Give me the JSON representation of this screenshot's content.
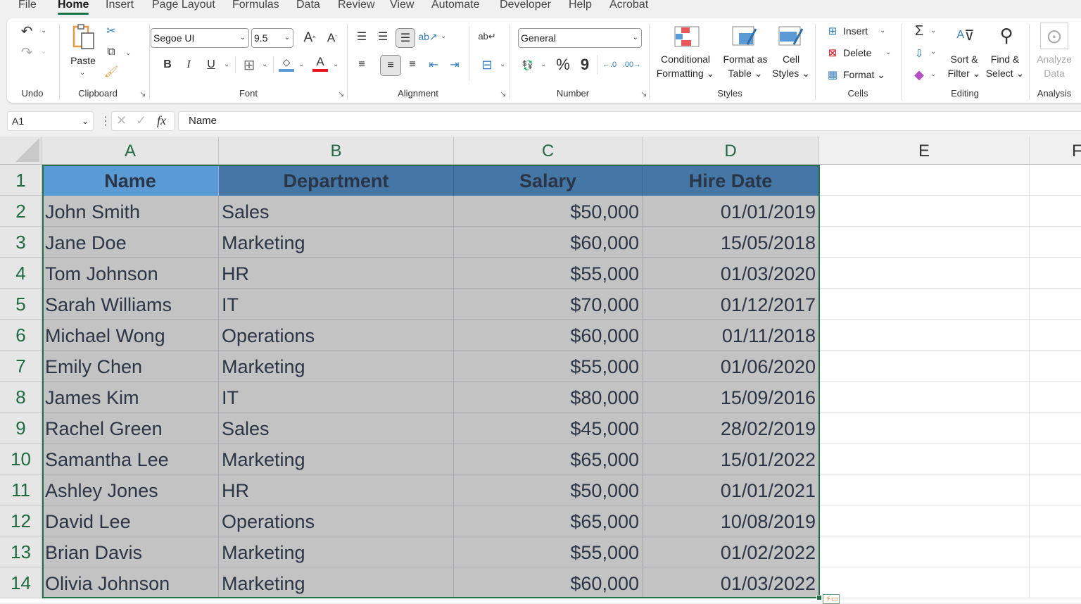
{
  "tabs": [
    "File",
    "Home",
    "Insert",
    "Page Layout",
    "Formulas",
    "Data",
    "Review",
    "View",
    "Automate",
    "Developer",
    "Help",
    "Acrobat"
  ],
  "active_tab": "Home",
  "ribbon": {
    "undo": {
      "label": "Undo"
    },
    "clipboard": {
      "label": "Clipboard",
      "paste": "Paste"
    },
    "font": {
      "label": "Font",
      "font_name": "Segoe UI",
      "font_size": "9.5",
      "bold": "B",
      "italic": "I",
      "underline": "U"
    },
    "alignment": {
      "label": "Alignment"
    },
    "number": {
      "label": "Number",
      "format": "General",
      "percent": "%",
      "comma": "9"
    },
    "styles": {
      "label": "Styles",
      "conditional_1": "Conditional",
      "conditional_2": "Formatting",
      "format_table_1": "Format as",
      "format_table_2": "Table",
      "cell_styles_1": "Cell",
      "cell_styles_2": "Styles"
    },
    "cells": {
      "label": "Cells",
      "insert": "Insert",
      "delete": "Delete",
      "format": "Format"
    },
    "editing": {
      "label": "Editing",
      "sort_1": "Sort &",
      "sort_2": "Filter",
      "find_1": "Find &",
      "find_2": "Select"
    },
    "analysis": {
      "label": "Analysis",
      "analyze_1": "Analyze",
      "analyze_2": "Data"
    }
  },
  "formula_bar": {
    "name_box": "A1",
    "fx": "fx",
    "content": "Name"
  },
  "columns": [
    "A",
    "B",
    "C",
    "D",
    "E",
    "F"
  ],
  "rows": [
    "1",
    "2",
    "3",
    "4",
    "5",
    "6",
    "7",
    "8",
    "9",
    "10",
    "11",
    "12",
    "13",
    "14"
  ],
  "table": {
    "headers": [
      "Name",
      "Department",
      "Salary",
      "Hire Date"
    ],
    "rows": [
      [
        "John Smith",
        "Sales",
        "$50,000",
        "01/01/2019"
      ],
      [
        "Jane Doe",
        "Marketing",
        "$60,000",
        "15/05/2018"
      ],
      [
        "Tom Johnson",
        "HR",
        "$55,000",
        "01/03/2020"
      ],
      [
        "Sarah Williams",
        "IT",
        "$70,000",
        "01/12/2017"
      ],
      [
        "Michael Wong",
        "Operations",
        "$60,000",
        "01/11/2018"
      ],
      [
        "Emily Chen",
        "Marketing",
        "$55,000",
        "01/06/2020"
      ],
      [
        "James Kim",
        "IT",
        "$80,000",
        "15/09/2016"
      ],
      [
        "Rachel Green",
        "Sales",
        "$45,000",
        "28/02/2019"
      ],
      [
        "Samantha Lee",
        "Marketing",
        "$65,000",
        "15/01/2022"
      ],
      [
        "Ashley Jones",
        "HR",
        "$50,000",
        "01/01/2021"
      ],
      [
        "David Lee",
        "Operations",
        "$65,000",
        "10/08/2019"
      ],
      [
        "Brian Davis",
        "Marketing",
        "$55,000",
        "01/02/2022"
      ],
      [
        "Olivia Johnson",
        "Marketing",
        "$60,000",
        "01/03/2022"
      ]
    ]
  },
  "colors": {
    "accent": "#217346",
    "header_selected": "#5b9bd5",
    "header": "#4477a6",
    "selection": "#c3c3c3"
  }
}
